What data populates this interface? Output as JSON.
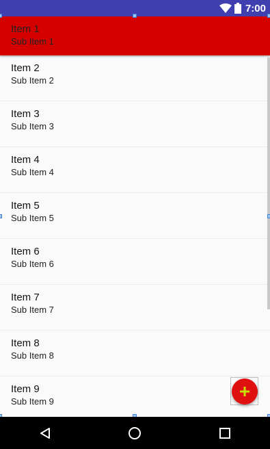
{
  "status_bar": {
    "time": "7:00",
    "icons": [
      "wifi-icon",
      "battery-icon"
    ]
  },
  "list": {
    "items": [
      {
        "title": "Item 1",
        "subtitle": "Sub Item 1",
        "selected": true
      },
      {
        "title": "Item 2",
        "subtitle": "Sub Item 2"
      },
      {
        "title": "Item 3",
        "subtitle": "Sub Item 3"
      },
      {
        "title": "Item 4",
        "subtitle": "Sub Item 4"
      },
      {
        "title": "Item 5",
        "subtitle": "Sub Item 5"
      },
      {
        "title": "Item 6",
        "subtitle": "Sub Item 6"
      },
      {
        "title": "Item 7",
        "subtitle": "Sub Item 7"
      },
      {
        "title": "Item 8",
        "subtitle": "Sub Item 8"
      },
      {
        "title": "Item 9",
        "subtitle": "Sub Item 9"
      }
    ]
  },
  "fab": {
    "icon": "plus-icon"
  },
  "nav_bar": {
    "icons": [
      "back-icon",
      "home-icon",
      "recents-icon"
    ]
  },
  "colors": {
    "status_bar": "#3f3fb0",
    "selected_row": "#d40000",
    "fab": "#e01010",
    "fab_icon": "#c8e000",
    "nav_bar": "#000000"
  }
}
